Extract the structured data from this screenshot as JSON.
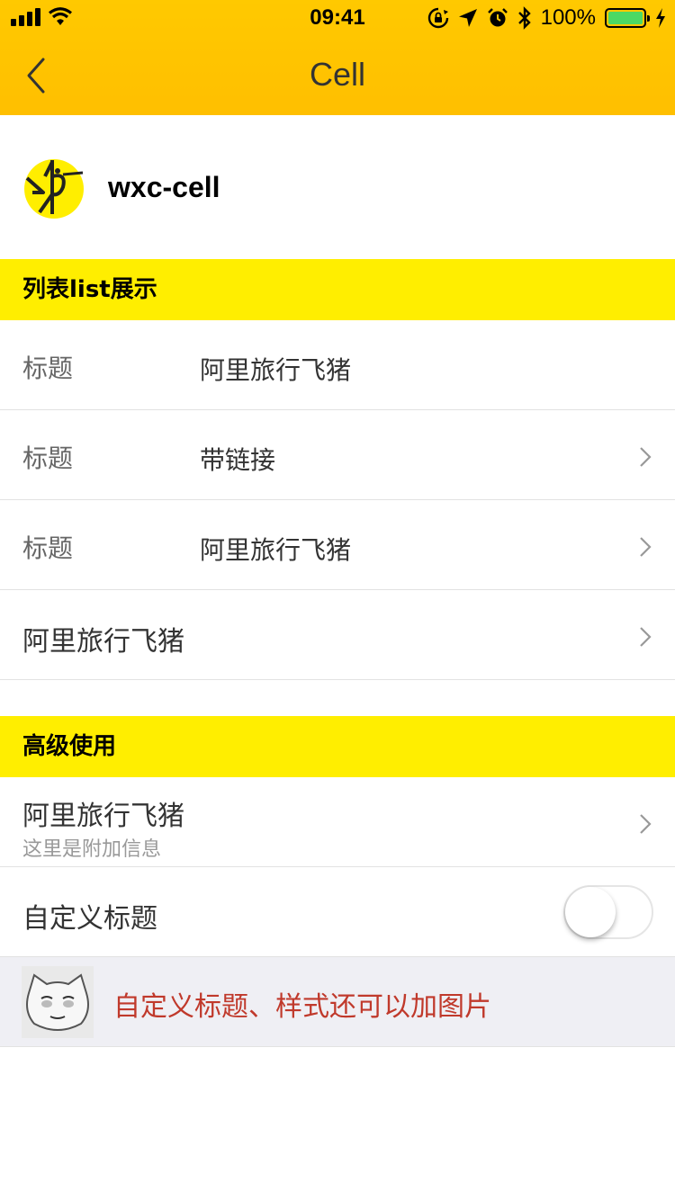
{
  "status_bar": {
    "time": "09:41",
    "battery_percent_text": "100%",
    "battery_level": 1.0,
    "battery_color": "#4cd964",
    "icons": [
      "signal-icon",
      "wifi-icon",
      "orientation-lock-icon",
      "location-icon",
      "alarm-icon",
      "bluetooth-icon",
      "battery-icon",
      "charging-icon"
    ]
  },
  "nav": {
    "title": "Cell",
    "back_icon": "chevron-left-icon",
    "background_color": "#ffc200"
  },
  "brand": {
    "name": "wxc-cell",
    "logo_icon": "fliggy-logo-icon"
  },
  "sections": {
    "list": {
      "title": "列表list展示",
      "background_color": "#ffee00"
    },
    "advanced": {
      "title": "高级使用",
      "background_color": "#ffee00"
    }
  },
  "list_cells": [
    {
      "label": "标题",
      "value": "阿里旅行飞猪",
      "has_arrow": false
    },
    {
      "label": "标题",
      "value": "带链接",
      "has_arrow": true
    },
    {
      "label": "标题",
      "value": "阿里旅行飞猪",
      "has_arrow": true
    },
    {
      "title": "阿里旅行飞猪",
      "has_arrow": true
    }
  ],
  "advanced_cells": {
    "desc_cell": {
      "title": "阿里旅行飞猪",
      "desc": "这里是附加信息",
      "has_arrow": true
    },
    "switch_cell": {
      "title": "自定义标题",
      "switch_on": false
    },
    "custom_cell": {
      "text": "自定义标题、样式还可以加图片",
      "text_color": "#c0392b",
      "image_icon": "cat-face-sticker"
    }
  }
}
